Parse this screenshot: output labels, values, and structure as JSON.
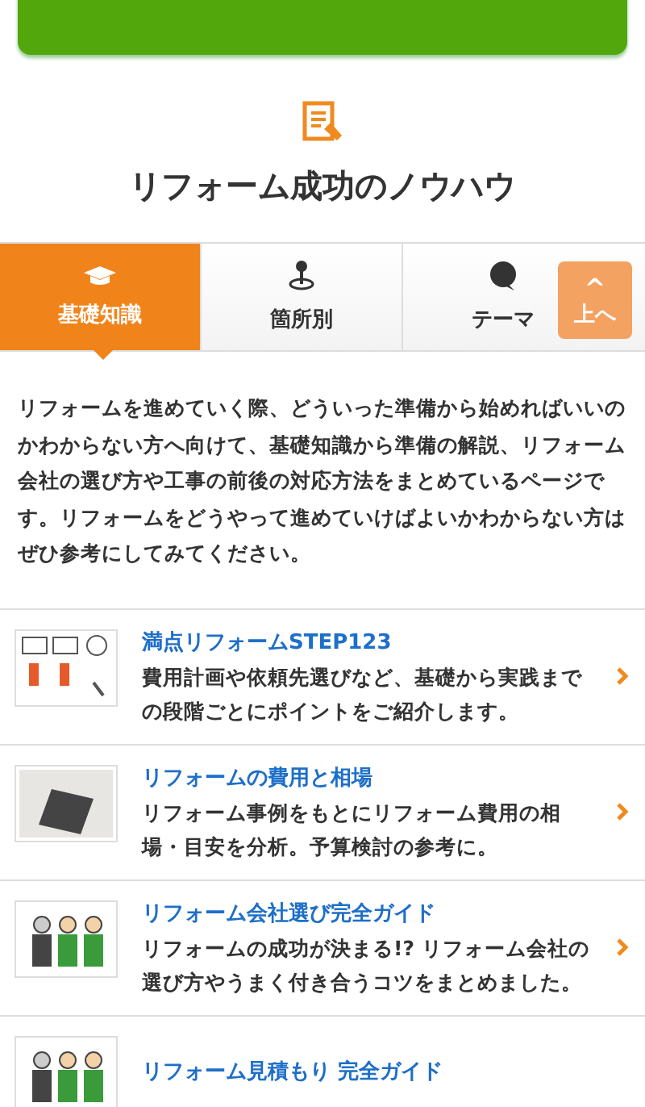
{
  "heading": "リフォーム成功のノウハウ",
  "tabs": [
    {
      "label": "基礎知識",
      "kind": "cap",
      "selected": true
    },
    {
      "label": "箇所別",
      "kind": "pin",
      "selected": false
    },
    {
      "label": "テーマ",
      "kind": "bubble",
      "selected": false
    }
  ],
  "back_to_top": {
    "label": "上へ",
    "icon": "^"
  },
  "intro": "リフォームを進めていく際、どういった準備から始めればいいのかわからない方へ向けて、基礎知識から準備の解説、リフォーム会社の選び方や工事の前後の対応方法をまとめているページです。リフォームをどうやって進めていけばよいかわからない方はぜひ参考にしてみてください。",
  "articles": [
    {
      "title": "満点リフォームSTEP123",
      "description": "費用計画や依頼先選びなど、基礎から実践までの段階ごとにポイントをご紹介します。",
      "kind": "steps"
    },
    {
      "title": "リフォームの費用と相場",
      "description": "リフォーム事例をもとにリフォーム費用の相場・目安を分析。予算検討の参考に。",
      "kind": "calculator"
    },
    {
      "title": "リフォーム会社選び完全ガイド",
      "description": "リフォームの成功が決まる!? リフォーム会社の選び方やうまく付き合うコツをまとめました。",
      "kind": "people"
    },
    {
      "title": "リフォーム見積もり 完全ガイド",
      "kind": "people"
    }
  ]
}
